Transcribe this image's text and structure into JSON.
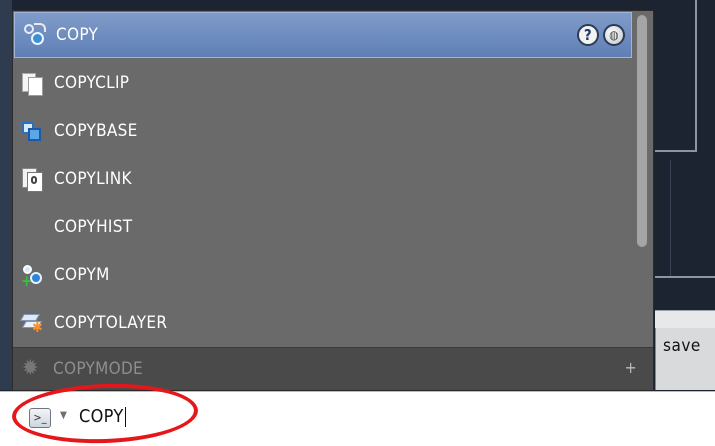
{
  "popup": {
    "items": [
      {
        "label": "COPY",
        "icon": "copy-icon",
        "selected": true
      },
      {
        "label": "COPYCLIP",
        "icon": "copyclip-icon"
      },
      {
        "label": "COPYBASE",
        "icon": "copybase-icon"
      },
      {
        "label": "COPYLINK",
        "icon": "copylink-icon"
      },
      {
        "label": "COPYHIST",
        "icon": ""
      },
      {
        "label": "COPYM",
        "icon": "copym-icon"
      },
      {
        "label": "COPYTOLAYER",
        "icon": "copytolayer-icon"
      }
    ],
    "disabled_item": {
      "label": "COPYMODE",
      "icon": "gear-icon"
    },
    "help_button": "?",
    "search_online_icon": "search-online-icon",
    "expand_symbol": "+"
  },
  "side": {
    "save_label": "save"
  },
  "command_line": {
    "text": "COPY",
    "prompt_icon": "command-prompt-icon",
    "prompt_glyph": ">_",
    "dropdown_glyph": "▼"
  },
  "annotation": {
    "color": "#e5171b"
  },
  "colors": {
    "popup_bg": "#6a6a6a",
    "selected_bg": "#6f8ec2",
    "disabled_row_bg": "#4a4a4a",
    "canvas_bg": "#1d2431"
  }
}
